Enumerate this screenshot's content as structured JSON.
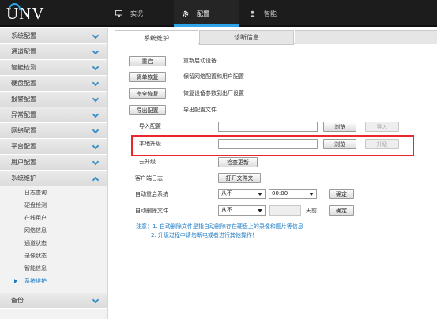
{
  "brand": {
    "logo_text": "UNV"
  },
  "nav": {
    "live": "实况",
    "config": "配置",
    "smart": "智能"
  },
  "sidebar": {
    "menus_top": [
      "系统配置",
      "通道配置",
      "智能检测",
      "硬盘配置",
      "报警配置",
      "异常配置",
      "网络配置",
      "平台配置",
      "用户配置",
      "系统维护"
    ],
    "submenus": [
      "日志查询",
      "硬盘检测",
      "在线用户",
      "网络信息",
      "通道状态",
      "录像状态",
      "智能信息",
      "系统维护"
    ],
    "active_sub": "系统维护",
    "menu_bottom": "备份"
  },
  "tabs": {
    "maintenance": "系统维护",
    "diagnostics": "诊断信息"
  },
  "actions": [
    {
      "button": "重启",
      "desc": "重新启动设备"
    },
    {
      "button": "简单恢复",
      "desc": "保留网络配置和用户配置"
    },
    {
      "button": "完全恢复",
      "desc": "恢复设备参数到出厂设置"
    },
    {
      "button": "导出配置",
      "desc": "导出配置文件"
    }
  ],
  "import_config": {
    "label": "导入配置",
    "path": "",
    "browse": "浏览",
    "action": "导入"
  },
  "local_upgrade": {
    "label": "本地升级",
    "path": "",
    "browse": "浏览",
    "action": "升级"
  },
  "cloud_upgrade": {
    "label": "云升级",
    "button": "检查更新"
  },
  "client_log": {
    "label": "客户端日志",
    "button": "打开文件夹"
  },
  "auto_reboot": {
    "label": "自动重启系统",
    "frequency": "从不",
    "time": "00:00",
    "confirm": "确定"
  },
  "auto_delete": {
    "label": "自动删除文件",
    "frequency": "从不",
    "days": "",
    "unit": "天前",
    "confirm": "确定"
  },
  "notes": {
    "line1": "注意：1. 自动删除文件是指自动删除存在硬盘上的录像和图片等信息",
    "line2": "2. 升级过程中请勿断电或者进行其他操作！"
  },
  "colors": {
    "accent": "#2ea5e8",
    "highlight": "#e8262b",
    "note": "#1a7ac4"
  }
}
